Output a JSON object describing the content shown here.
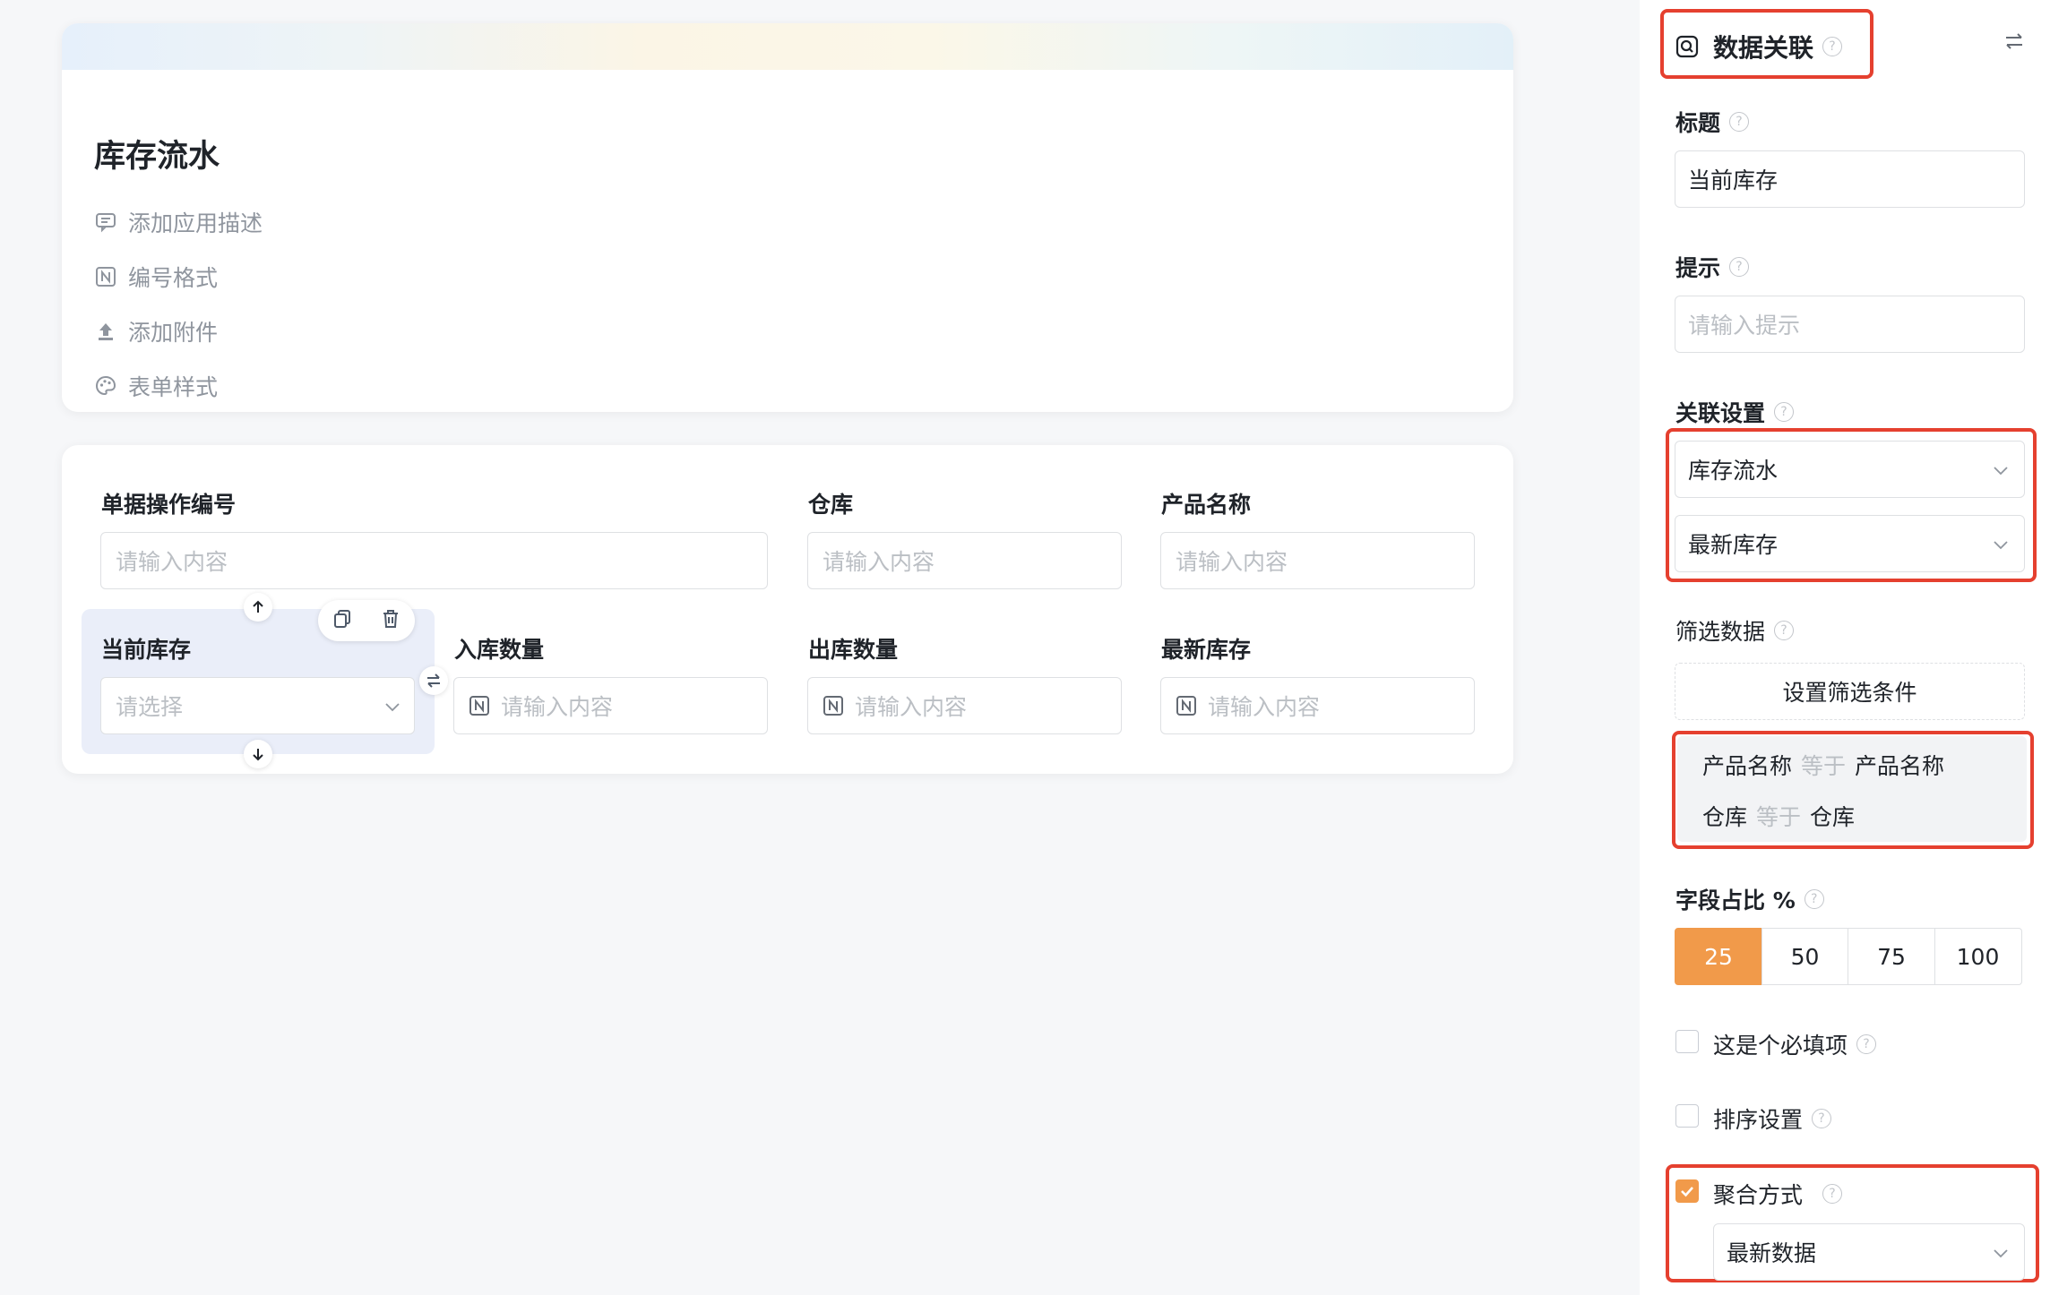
{
  "app": {
    "title": "库存流水",
    "meta": [
      {
        "label": "添加应用描述",
        "icon": "comment-icon"
      },
      {
        "label": "编号格式",
        "icon": "number-format-icon"
      },
      {
        "label": "添加附件",
        "icon": "upload-icon"
      },
      {
        "label": "表单样式",
        "icon": "palette-icon"
      }
    ]
  },
  "form": {
    "row1": [
      {
        "label": "单据操作编号",
        "placeholder": "请输入内容"
      },
      {
        "label": "仓库",
        "placeholder": "请输入内容"
      },
      {
        "label": "产品名称",
        "placeholder": "请输入内容"
      }
    ],
    "row2": [
      {
        "label": "当前库存",
        "placeholder": "请选择"
      },
      {
        "label": "入库数量",
        "placeholder": "请输入内容"
      },
      {
        "label": "出库数量",
        "placeholder": "请输入内容"
      },
      {
        "label": "最新库存",
        "placeholder": "请输入内容"
      }
    ]
  },
  "panel": {
    "header": "数据关联",
    "title_label": "标题",
    "title_value": "当前库存",
    "hint_label": "提示",
    "hint_placeholder": "请输入提示",
    "relation_label": "关联设置",
    "relation_form": "库存流水",
    "relation_field": "最新库存",
    "filter_label": "筛选数据",
    "filter_button": "设置筛选条件",
    "filters": [
      {
        "left": "产品名称",
        "op": "等于",
        "right": "产品名称"
      },
      {
        "left": "仓库",
        "op": "等于",
        "right": "仓库"
      }
    ],
    "width_label": "字段占比 %",
    "width_options": [
      "25",
      "50",
      "75",
      "100"
    ],
    "width_selected": "25",
    "required_label": "这是个必填项",
    "sort_label": "排序设置",
    "aggregate_label": "聚合方式",
    "aggregate_value": "最新数据",
    "accent_color": "#f19a4a",
    "highlight_color": "#e5402f"
  }
}
